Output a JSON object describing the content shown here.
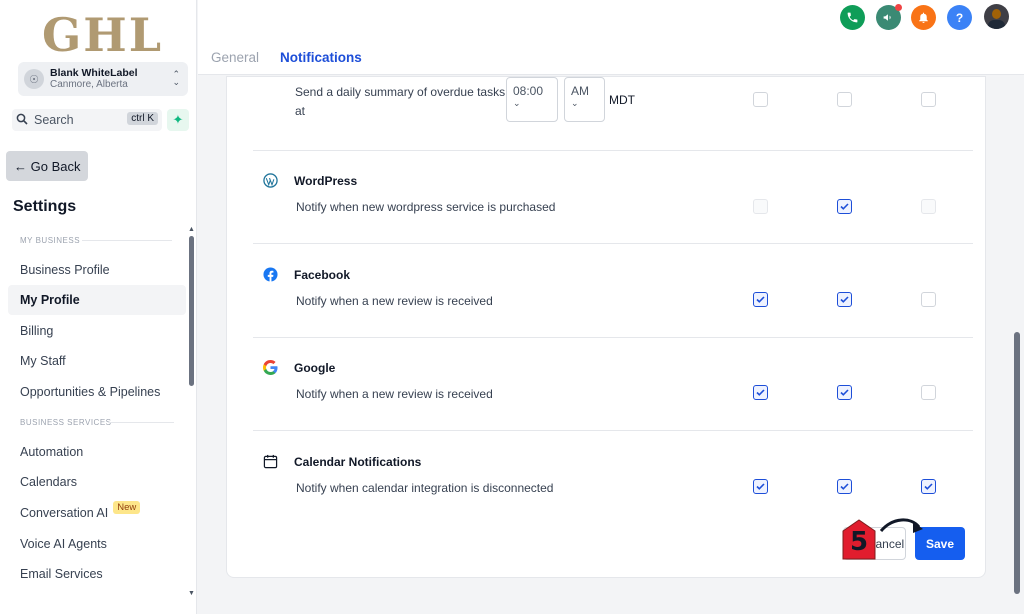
{
  "sidebar": {
    "logo": "GHL",
    "account": {
      "name": "Blank WhiteLabel",
      "location": "Canmore, Alberta"
    },
    "search": {
      "label": "Search",
      "shortcut": "ctrl K"
    },
    "go_back": "← Go Back",
    "title": "Settings",
    "sections": [
      {
        "label": "MY BUSINESS"
      },
      {
        "label": "BUSINESS SERVICES"
      }
    ],
    "items": [
      {
        "label": "Business Profile"
      },
      {
        "label": "My Profile"
      },
      {
        "label": "Billing"
      },
      {
        "label": "My Staff"
      },
      {
        "label": "Opportunities & Pipelines"
      },
      {
        "label": "Automation"
      },
      {
        "label": "Calendars"
      },
      {
        "label": "Conversation AI",
        "badge": "New"
      },
      {
        "label": "Voice AI Agents"
      },
      {
        "label": "Email Services"
      }
    ]
  },
  "header": {
    "tabs": [
      {
        "label": "General"
      },
      {
        "label": "Notifications"
      }
    ],
    "help": "?"
  },
  "colors": {
    "phone": "#0f9d58",
    "announce": "#3b8a74",
    "bell": "#f97316",
    "help": "#3b82f6",
    "primary": "#155eef"
  },
  "content": {
    "summary": {
      "text_line1": "Send a daily summary of overdue tasks",
      "text_line2": "at",
      "hour": "08:00",
      "ampm": "AM",
      "timezone": "MDT",
      "checks": [
        "unchecked",
        "unchecked",
        "unchecked"
      ]
    },
    "rows": [
      {
        "title": "WordPress",
        "desc": "Notify when new wordpress service is purchased",
        "icon": "wordpress-icon",
        "checks": [
          "disabled",
          "checked",
          "disabled"
        ]
      },
      {
        "title": "Facebook",
        "desc": "Notify when a new review is received",
        "icon": "facebook-icon",
        "checks": [
          "checked",
          "checked",
          "unchecked"
        ]
      },
      {
        "title": "Google",
        "desc": "Notify when a new review is received",
        "icon": "google-icon",
        "checks": [
          "checked",
          "checked",
          "unchecked"
        ]
      },
      {
        "title": "Calendar Notifications",
        "desc": "Notify when calendar integration is disconnected",
        "icon": "calendar-icon",
        "checks": [
          "checked",
          "checked",
          "checked"
        ]
      }
    ],
    "buttons": {
      "cancel": "Cancel",
      "save": "Save"
    },
    "step_marker": "5"
  }
}
